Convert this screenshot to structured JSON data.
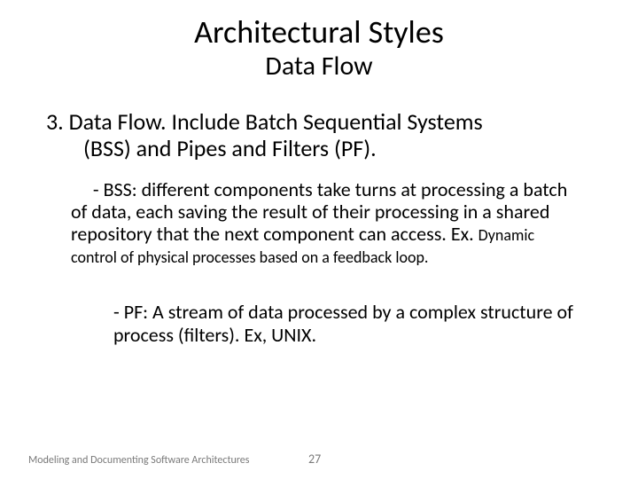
{
  "title": "Architectural Styles",
  "subtitle": "Data Flow",
  "section": {
    "heading_line1": "3. Data Flow. Include Batch Sequential Systems",
    "heading_line2": "(BSS) and Pipes and Filters (PF)."
  },
  "bss": {
    "lead_spaces": "     ",
    "main": "- BSS: different components take turns at processing a batch of data, each saving the result of their processing in a shared repository that the next component can access. Ex. ",
    "example": "Dynamic control of physical processes based on a feedback loop."
  },
  "pf": {
    "text": "- PF: A stream of data processed by a complex structure of process (filters). Ex, UNIX."
  },
  "footer": {
    "source": "Modeling and Documenting Software Architectures",
    "page": "27"
  }
}
